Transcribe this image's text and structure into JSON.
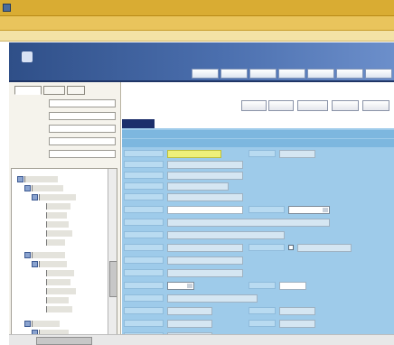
{
  "window": {
    "title": "",
    "menu": [
      "",
      "",
      "",
      "",
      "",
      ""
    ]
  },
  "banner": {
    "brand": "",
    "tagline": ""
  },
  "nav": {
    "tabs": [
      "",
      "",
      "",
      "",
      "",
      "",
      ""
    ]
  },
  "left_panel": {
    "tabs": [
      {
        "label": "",
        "active": true
      },
      {
        "label": "",
        "active": false
      },
      {
        "label": "",
        "active": false
      }
    ],
    "fields": [
      {
        "label": "",
        "value": ""
      },
      {
        "label": "",
        "value": ""
      },
      {
        "label": "",
        "value": ""
      },
      {
        "label": "",
        "value": ""
      },
      {
        "label": "",
        "value": ""
      }
    ]
  },
  "main": {
    "screen_title": "",
    "actions": [
      "",
      "",
      "",
      "",
      ""
    ],
    "section_tab": "",
    "form_rows": 18
  },
  "colors": {
    "accent": "#1c2f6b",
    "form_bg": "#9ecbea",
    "title_bar": "#d9ac33"
  }
}
